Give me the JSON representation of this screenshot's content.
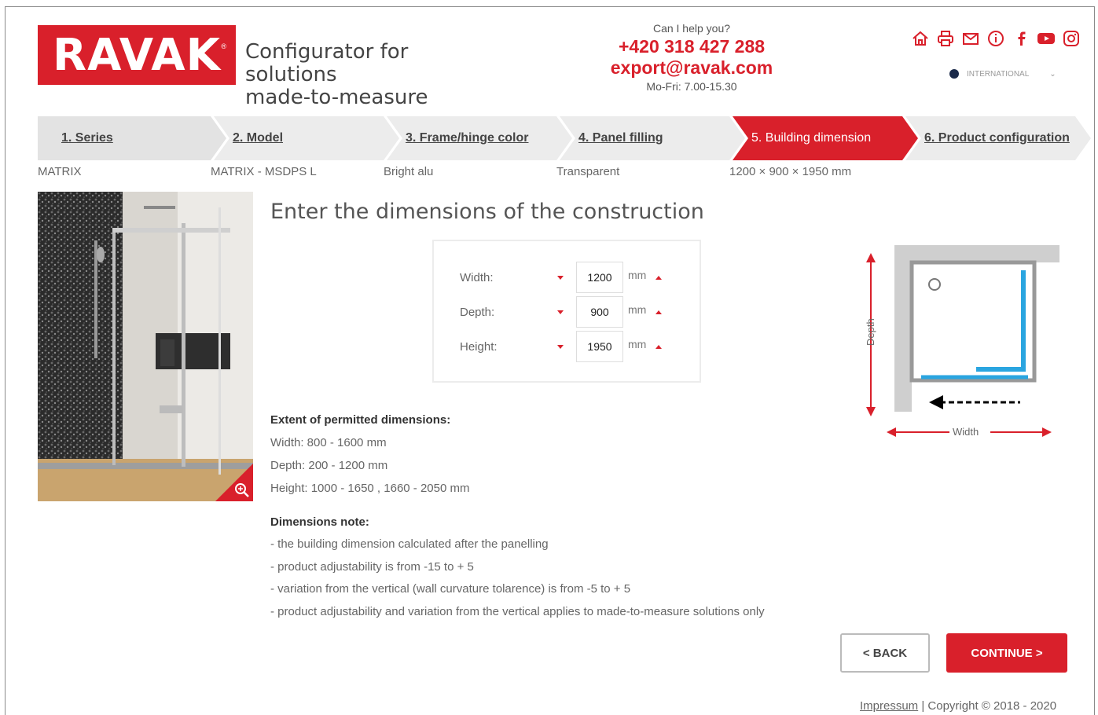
{
  "brand": {
    "logo_text": "RAVAK",
    "tagline_line1": "Configurator for solutions",
    "tagline_line2": "made-to-measure"
  },
  "contact": {
    "ask": "Can I help you?",
    "phone": "+420 318 427 288",
    "email": "export@ravak.com",
    "hours": "Mo-Fri: 7.00-15.30"
  },
  "language": {
    "selected": "INTERNATIONAL"
  },
  "steps": [
    {
      "label": "1. Series",
      "value": "MATRIX"
    },
    {
      "label": "2. Model",
      "value": "MATRIX - MSDPS L"
    },
    {
      "label": "3. Frame/hinge color",
      "value": "Bright alu"
    },
    {
      "label": "4. Panel filling",
      "value": "Transparent"
    },
    {
      "label": "5. Building dimension",
      "value": "1200 × 900 × 1950 mm"
    },
    {
      "label": "6. Product configuration",
      "value": ""
    }
  ],
  "form": {
    "title": "Enter the dimensions of the construction",
    "rows": [
      {
        "label": "Width:",
        "value": "1200",
        "unit": "mm"
      },
      {
        "label": "Depth:",
        "value": "900",
        "unit": "mm"
      },
      {
        "label": "Height:",
        "value": "1950",
        "unit": "mm"
      }
    ]
  },
  "permitted": {
    "title": "Extent of permitted dimensions:",
    "width": "Width: 800 - 1600 mm",
    "depth": "Depth: 200 - 1200 mm",
    "height": "Height: 1000 - 1650 , 1660 - 2050 mm"
  },
  "notes": {
    "title": "Dimensions note:",
    "items": [
      "- the building dimension calculated after the panelling",
      "- product adjustability is from -15 to + 5",
      "- variation from the vertical (wall curvature tolarence) is from -5 to + 5",
      "- product adjustability and variation from the vertical applies to made-to-measure solutions only"
    ]
  },
  "diagram": {
    "depth_label": "Depth",
    "width_label": "Width"
  },
  "buttons": {
    "back": "< BACK",
    "continue": "CONTINUE >"
  },
  "footer": {
    "impressum": "Impressum",
    "copyright": " | Copyright © 2018 - 2020"
  },
  "colors": {
    "accent": "#d9202b",
    "step_bg": "#e6e6e6",
    "glass_edge": "#2aa5e0"
  }
}
